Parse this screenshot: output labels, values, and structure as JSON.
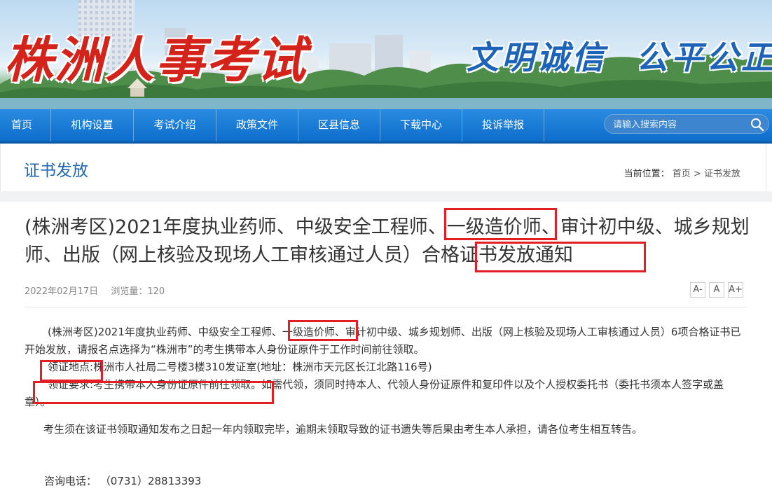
{
  "banner": {
    "site_title": "株洲人事考试",
    "slogan_1": "文明诚信",
    "slogan_2": "公平公正"
  },
  "nav": {
    "items": [
      "首页",
      "机构设置",
      "考试介绍",
      "政策文件",
      "区县信息",
      "下载中心",
      "投诉举报"
    ],
    "search_placeholder": "请输入搜索内容"
  },
  "page_header": {
    "title": "证书发放",
    "breadcrumb_label": "当前位置：",
    "breadcrumb_home": "首页",
    "breadcrumb_sep": ">",
    "breadcrumb_current": "证书发放"
  },
  "article": {
    "title_part1": "(株洲考区)2021年度执业药师、中级安全工程师、",
    "title_hl1": "一级造价师",
    "title_part2": "、审计初中级、城乡规划师、出版（网上核验及现场人工审核通过人员）",
    "title_hl2": "合格证书发放通知",
    "date": "2022年02月17日",
    "views": "浏览量：120",
    "font_small": "A-",
    "font_normal": "A",
    "font_large": "A+",
    "p1_part1": "(株洲考区)2021年度执业药师、中级安全工程师、",
    "p1_hl": "一级造价师",
    "p1_part2": "、审计初中级、城乡规划师、出版（网上核验及现场人工审核通过人员）6项合格证书已开始发放，请报名点选择为“株洲市”的考生携带本人身份证原件于工作时间前往领取。",
    "p2_label": "领证地点:",
    "p2_text": "株洲市人社局二号楼3楼310发证室(地址：株洲市天元区长江北路116号)",
    "p3_label": "领证要求:",
    "p3_hl": "考生携带本人身份证原件前往领取",
    "p3_text": "。如需代领，须同时持本人、代领人身份证原件和复印件以及个人授权委托书（委托书须本人签字或盖章）。",
    "p4": "考生须在该证书领取通知发布之日起一年内领取完毕，逾期未领取导致的证书遗失等后果由考生本人承担，请各位考生相互转告。",
    "contact_label": "咨询电话：",
    "contact_phone": "（0731）28813393"
  },
  "colors": {
    "nav_blue": "#0d6dcb",
    "title_blue": "#2266b0",
    "annotation_red": "#e31e24",
    "banner_red": "#d4231a"
  }
}
